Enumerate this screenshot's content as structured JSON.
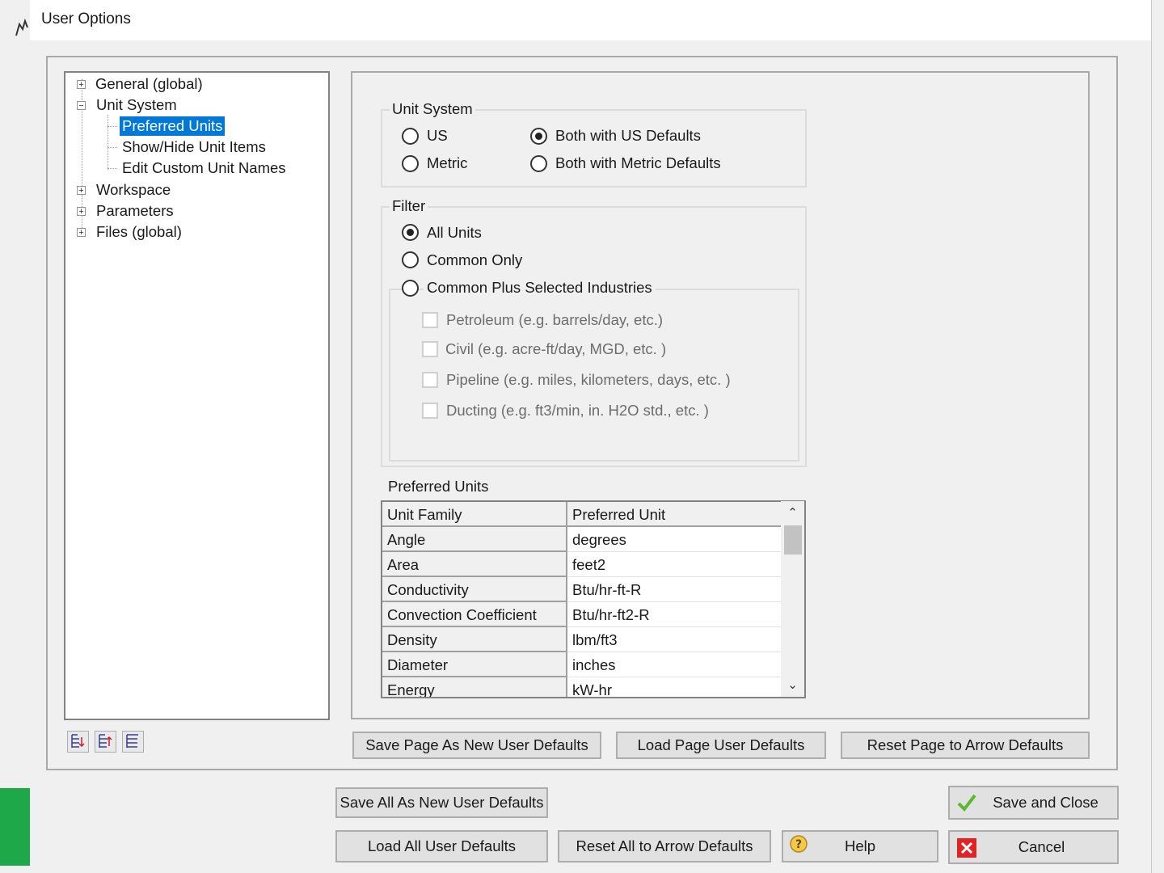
{
  "window": {
    "title": "User Options"
  },
  "tree": {
    "items": [
      {
        "label": "General (global)"
      },
      {
        "label": "Unit System"
      },
      {
        "label": "Preferred Units"
      },
      {
        "label": "Show/Hide Unit Items"
      },
      {
        "label": "Edit Custom Unit Names"
      },
      {
        "label": "Workspace"
      },
      {
        "label": "Parameters"
      },
      {
        "label": "Files (global)"
      }
    ],
    "selected": "Preferred Units"
  },
  "unit_system": {
    "label": "Unit System",
    "options": [
      {
        "label": "US",
        "checked": false
      },
      {
        "label": "Metric",
        "checked": false
      },
      {
        "label": "Both with US Defaults",
        "checked": true
      },
      {
        "label": "Both with Metric Defaults",
        "checked": false
      }
    ]
  },
  "filter": {
    "label": "Filter",
    "options": [
      {
        "label": "All Units",
        "checked": true
      },
      {
        "label": "Common Only",
        "checked": false
      },
      {
        "label": "Common Plus Selected Industries",
        "checked": false
      }
    ],
    "industries": [
      {
        "label": "Petroleum (e.g. barrels/day, etc.)",
        "checked": false
      },
      {
        "label": "Civil (e.g. acre-ft/day, MGD, etc. )",
        "checked": false
      },
      {
        "label": "Pipeline (e.g. miles, kilometers, days, etc. )",
        "checked": false
      },
      {
        "label": "Ducting (e.g. ft3/min, in. H2O std., etc. )",
        "checked": false
      }
    ]
  },
  "preferred_units": {
    "label": "Preferred Units",
    "columns": [
      "Unit Family",
      "Preferred Unit"
    ],
    "rows": [
      [
        "Angle",
        "degrees"
      ],
      [
        "Area",
        "feet2"
      ],
      [
        "Conductivity",
        "Btu/hr-ft-R"
      ],
      [
        "Convection Coefficient",
        "Btu/hr-ft2-R"
      ],
      [
        "Density",
        "lbm/ft3"
      ],
      [
        "Diameter",
        "inches"
      ],
      [
        "Energy",
        "kW-hr"
      ]
    ]
  },
  "page_buttons": {
    "save_page": "Save Page As New User Defaults",
    "load_page": "Load Page User Defaults",
    "reset_page": "Reset Page to Arrow Defaults"
  },
  "bottom_buttons": {
    "save_all": "Save All As New User Defaults",
    "load_all": "Load All User Defaults",
    "reset_all": "Reset All to Arrow Defaults",
    "help": "Help",
    "save_close": "Save and Close",
    "cancel": "Cancel"
  },
  "colors": {
    "selection": "#0078d7",
    "accent_green": "#1fa84a",
    "cancel_red": "#e02424",
    "check_green": "#5cb82e"
  },
  "icons": {
    "expand_tree": "expand-tree-icon",
    "collapse_tree": "collapse-tree-icon",
    "tree_options": "tree-options-icon",
    "save_close": "checkmark-icon",
    "cancel": "close-icon",
    "help": "help-icon"
  }
}
